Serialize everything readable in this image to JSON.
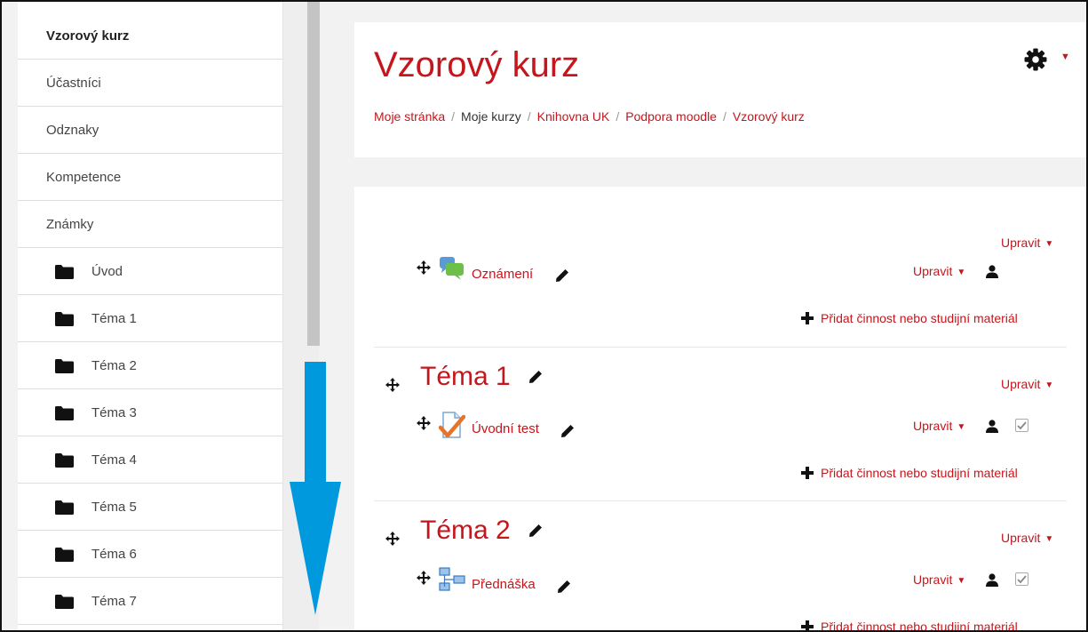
{
  "sidebar": {
    "items": [
      {
        "label": "Vzorový kurz"
      },
      {
        "label": "Účastníci"
      },
      {
        "label": "Odznaky"
      },
      {
        "label": "Kompetence"
      },
      {
        "label": "Známky"
      },
      {
        "label": "Úvod"
      },
      {
        "label": "Téma 1"
      },
      {
        "label": "Téma 2"
      },
      {
        "label": "Téma 3"
      },
      {
        "label": "Téma 4"
      },
      {
        "label": "Téma 5"
      },
      {
        "label": "Téma 6"
      },
      {
        "label": "Téma 7"
      }
    ]
  },
  "header": {
    "title": "Vzorový kurz",
    "breadcrumb": [
      "Moje stránka",
      "Moje kurzy",
      "Knihovna UK",
      "Podpora moodle",
      "Vzorový kurz"
    ],
    "separator": "/"
  },
  "sections": [
    {
      "title": "",
      "edit_label": "Upravit",
      "activity": {
        "name": "Oznámení",
        "icon": "forum-icon",
        "edit_label": "Upravit",
        "has_completion": false
      },
      "add_label": "Přidat činnost nebo studijní materiál"
    },
    {
      "title": "Téma 1",
      "edit_label": "Upravit",
      "activity": {
        "name": "Úvodní test",
        "icon": "quiz-icon",
        "edit_label": "Upravit",
        "has_completion": true
      },
      "add_label": "Přidat činnost nebo studijní materiál"
    },
    {
      "title": "Téma 2",
      "edit_label": "Upravit",
      "activity": {
        "name": "Přednáška",
        "icon": "lesson-icon",
        "edit_label": "Upravit",
        "has_completion": true
      },
      "add_label": "Přidat činnost nebo studijní materiál"
    }
  ],
  "colors": {
    "accent": "#c4161c",
    "arrow": "#0099dd"
  }
}
